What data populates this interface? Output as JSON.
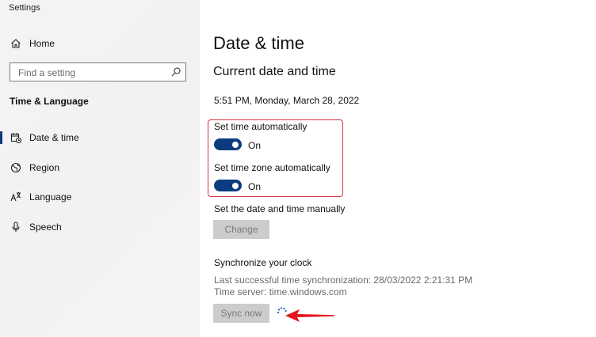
{
  "window": {
    "title": "Settings"
  },
  "sidebar": {
    "home_label": "Home",
    "search_placeholder": "Find a setting",
    "section_header": "Time & Language",
    "items": [
      {
        "label": "Date & time",
        "icon": "calendar-clock-icon",
        "selected": true
      },
      {
        "label": "Region",
        "icon": "globe-icon",
        "selected": false
      },
      {
        "label": "Language",
        "icon": "language-icon",
        "selected": false
      },
      {
        "label": "Speech",
        "icon": "microphone-icon",
        "selected": false
      }
    ]
  },
  "main": {
    "title": "Date & time",
    "subtitle": "Current date and time",
    "current_datetime": "5:51 PM, Monday, March 28, 2022",
    "set_time_auto": {
      "label": "Set time automatically",
      "state": "On"
    },
    "set_timezone_auto": {
      "label": "Set time zone automatically",
      "state": "On"
    },
    "manual": {
      "label": "Set the date and time manually",
      "button": "Change"
    },
    "sync": {
      "heading": "Synchronize your clock",
      "last_sync": "Last successful time synchronization: 28/03/2022 2:21:31 PM",
      "time_server": "Time server: time.windows.com",
      "button": "Sync now"
    }
  },
  "colors": {
    "accent": "#0d3c7e",
    "highlight_border": "#d8323e",
    "annotation_arrow": "#e5141e",
    "disabled_button": "#cccccc"
  }
}
